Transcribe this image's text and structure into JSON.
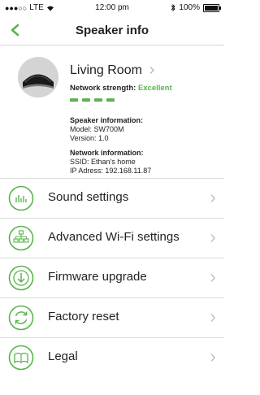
{
  "status_bar": {
    "carrier": "LTE",
    "time": "12:00 pm",
    "battery": "100%"
  },
  "nav": {
    "title": "Speaker info"
  },
  "speaker": {
    "name": "Living Room",
    "network_strength_label": "Network strength:",
    "network_strength_value": "Excellent",
    "network_strength_level": 4,
    "speaker_info_heading": "Speaker information:",
    "model": "Model: SW700M",
    "version": "Version: 1.0",
    "network_info_heading": "Network information:",
    "ssid": "SSID: Ethan's home",
    "ip": "IP Adress: 192.168.11.87"
  },
  "menu": [
    {
      "label": "Sound settings",
      "icon": "equalizer-icon"
    },
    {
      "label": "Advanced Wi-Fi settings",
      "icon": "network-icon"
    },
    {
      "label": "Firmware upgrade",
      "icon": "download-icon"
    },
    {
      "label": "Factory reset",
      "icon": "refresh-icon"
    },
    {
      "label": "Legal",
      "icon": "book-icon"
    }
  ],
  "colors": {
    "accent": "#5cb34f"
  }
}
